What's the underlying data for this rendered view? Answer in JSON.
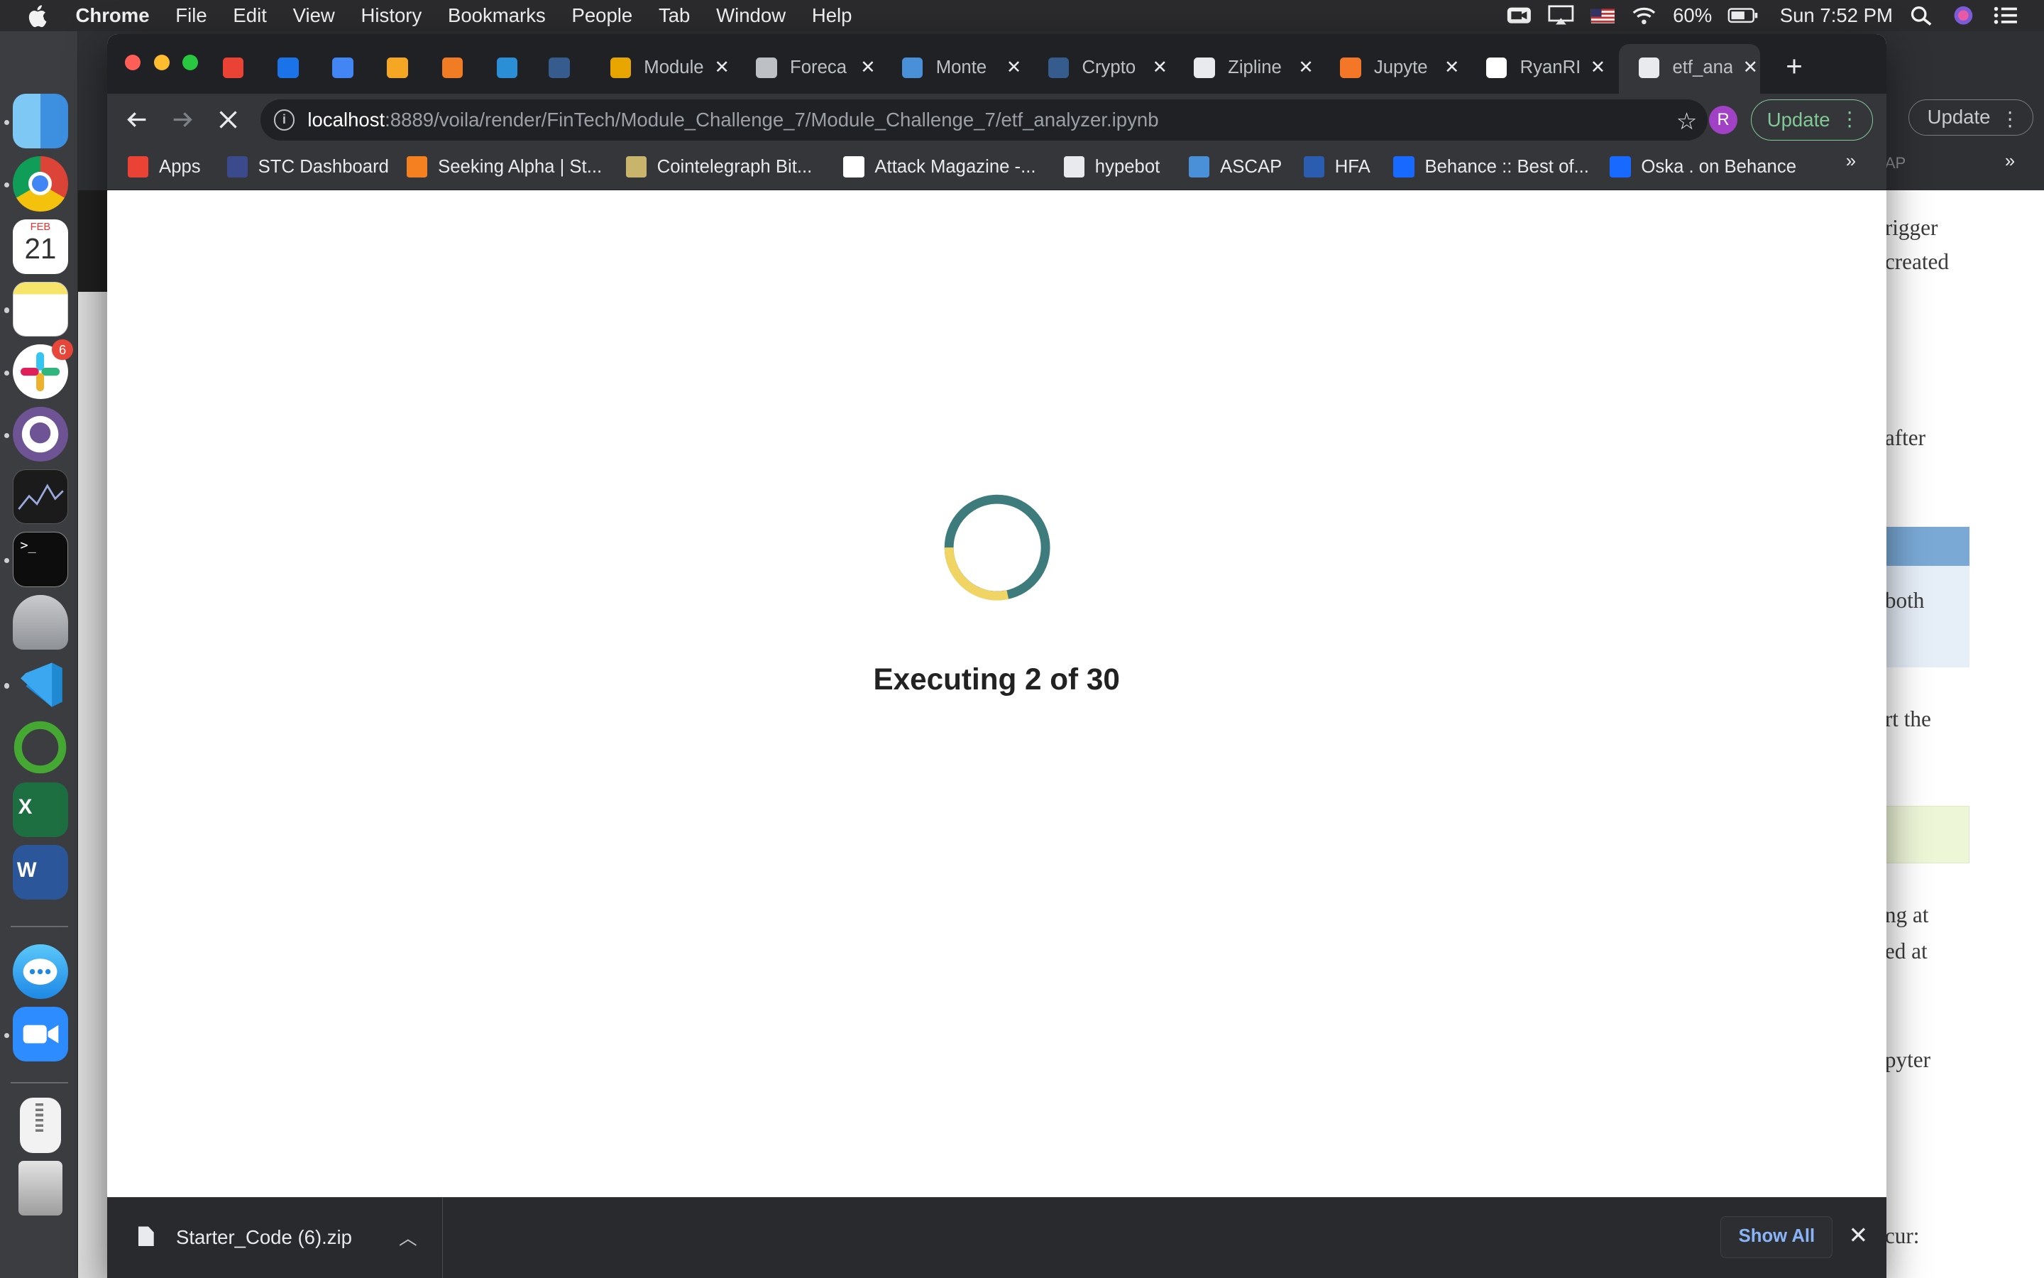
{
  "menubar": {
    "app": "Chrome",
    "items": [
      "File",
      "Edit",
      "View",
      "History",
      "Bookmarks",
      "People",
      "Tab",
      "Window",
      "Help"
    ],
    "battery": "60%",
    "clock": "Sun 7:52 PM"
  },
  "dock": {
    "calendar_month": "FEB",
    "calendar_day": "21",
    "slack_badge": "6"
  },
  "tabs": [
    {
      "label": "",
      "icon": "gmail-icon",
      "color": "#ea4335"
    },
    {
      "label": "",
      "icon": "outlook-icon",
      "color": "#1a73e8"
    },
    {
      "label": "",
      "icon": "docs-icon",
      "color": "#4285f4"
    },
    {
      "label": "",
      "icon": "coinbase-icon",
      "color": "#f5a623"
    },
    {
      "label": "",
      "icon": "c-icon",
      "color": "#f07c24"
    },
    {
      "label": "",
      "icon": "p-icon",
      "color": "#2a8fd6"
    },
    {
      "label": "",
      "icon": "tds-icon",
      "color": "#355c8c"
    },
    {
      "label": "Module",
      "icon": "coin-icon",
      "color": "#e8a500"
    },
    {
      "label": "Foreca",
      "icon": "doc-grid-icon",
      "color": "#bdc1c6"
    },
    {
      "label": "Monte",
      "icon": "pb-icon",
      "color": "#4a90d9"
    },
    {
      "label": "Crypto",
      "icon": "tds-icon",
      "color": "#355c8c"
    },
    {
      "label": "Zipline",
      "icon": "globe-icon",
      "color": "#e8eaed"
    },
    {
      "label": "Jupyte",
      "icon": "jupyter-icon",
      "color": "#f37726"
    },
    {
      "label": "RyanRI",
      "icon": "github-icon",
      "color": "#ffffff"
    },
    {
      "label": "etf_ana",
      "icon": "loading-icon",
      "color": "#e8eaed"
    }
  ],
  "address": {
    "host": "localhost",
    "path": ":8889/voila/render/FinTech/Module_Challenge_7/Module_Challenge_7/etf_analyzer.ipynb"
  },
  "profile_initial": "R",
  "update_label": "Update",
  "bookmarks": [
    {
      "label": "Apps",
      "color": "#ea4335"
    },
    {
      "label": "STC Dashboard",
      "color": "#3a4a8c"
    },
    {
      "label": "Seeking Alpha | St...",
      "color": "#f58020"
    },
    {
      "label": "Cointelegraph Bit...",
      "color": "#c8b46a"
    },
    {
      "label": "Attack Magazine -...",
      "color": "#ffffff"
    },
    {
      "label": "hypebot",
      "color": "#e8eaed"
    },
    {
      "label": "ASCAP",
      "color": "#4a90d9"
    },
    {
      "label": "HFA",
      "color": "#2a5db0"
    },
    {
      "label": "Behance :: Best of...",
      "color": "#1769ff"
    },
    {
      "label": "Oska . on Behance",
      "color": "#1769ff"
    }
  ],
  "status": {
    "text": "Executing 2 of 30",
    "current": 2,
    "total": 30
  },
  "download": {
    "filename": "Starter_Code (6).zip",
    "show_all": "Show All"
  },
  "background_window": {
    "update_label": "Update",
    "ap_fragment": "AP",
    "text_fragments": [
      "rigger",
      "created",
      "after",
      "both",
      "rt the",
      "ng at",
      "ed at",
      "pyter",
      "cur:"
    ]
  }
}
